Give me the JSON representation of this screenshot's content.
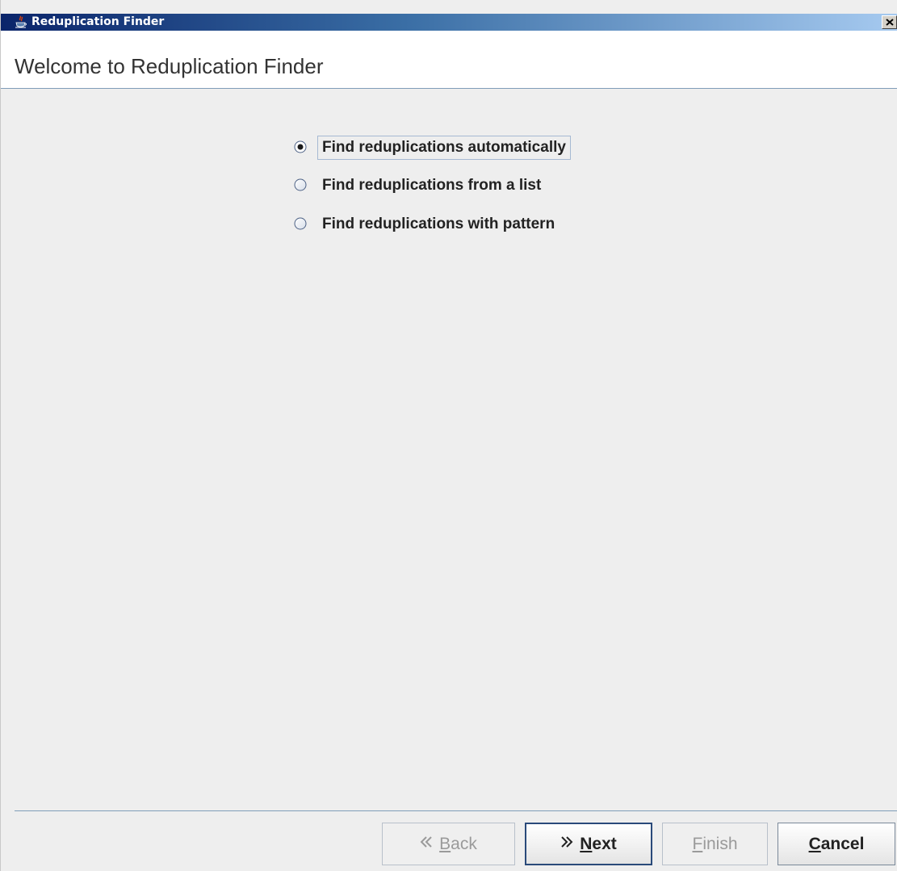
{
  "window": {
    "title": "Reduplication Finder"
  },
  "header": {
    "title": "Welcome to Reduplication Finder"
  },
  "options": [
    {
      "label": "Find reduplications automatically",
      "selected": true
    },
    {
      "label": "Find reduplications from a list",
      "selected": false
    },
    {
      "label": "Find reduplications with pattern",
      "selected": false
    }
  ],
  "buttons": {
    "back": {
      "mnemonic": "B",
      "rest": "ack",
      "enabled": false
    },
    "next": {
      "mnemonic": "N",
      "rest": "ext",
      "enabled": true
    },
    "finish": {
      "mnemonic": "F",
      "rest": "inish",
      "enabled": false
    },
    "cancel": {
      "mnemonic": "C",
      "rest": "ancel",
      "enabled": true
    }
  },
  "icons": {
    "app": "java-coffee-cup-icon",
    "close": "close-icon",
    "back": "double-chevron-left-icon",
    "next": "double-chevron-right-icon"
  },
  "colors": {
    "titlebar_start": "#0a246a",
    "titlebar_end": "#a6caf0",
    "background": "#eeeeee",
    "header_background": "#ffffff",
    "divider": "#7f9db9"
  }
}
